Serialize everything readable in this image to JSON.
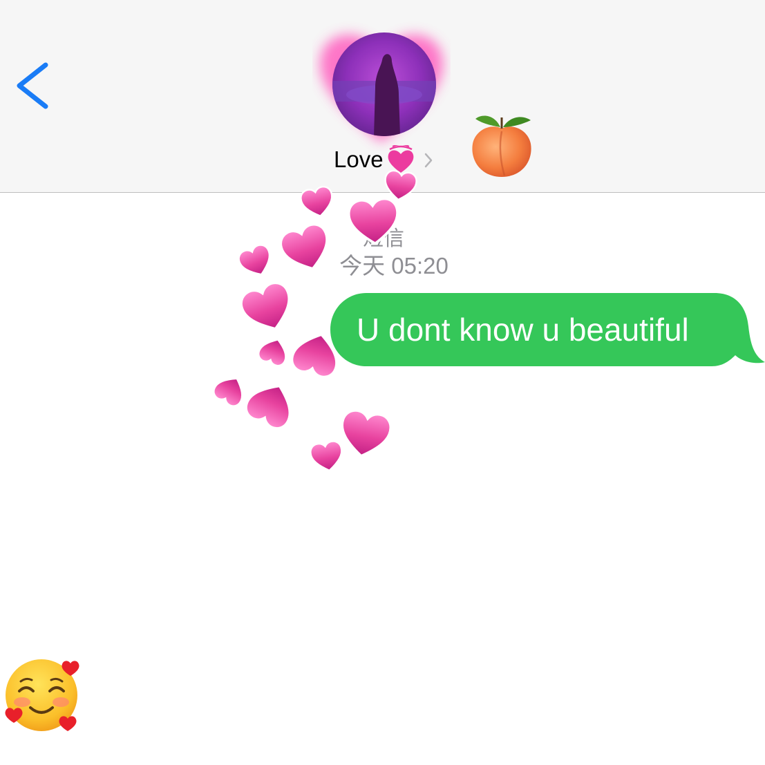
{
  "header": {
    "contact_name": "Love",
    "back_icon": "chevron-left-icon",
    "chevron_icon": "chevron-right-icon",
    "name_emoji": "sparkling-heart-icon",
    "decoration_emoji": "peach-icon"
  },
  "conversation": {
    "service_label": "短信",
    "timestamp": "今天  05:20",
    "messages": [
      {
        "direction": "outgoing",
        "text": "U dont know u beautiful"
      }
    ]
  },
  "stickers": [
    "floating-pink-hearts",
    "smiling-face-with-hearts-icon"
  ],
  "colors": {
    "accent_blue": "#1a7cf6",
    "sms_bubble": "#35c759",
    "timestamp_gray": "#8e8e93",
    "header_bg": "#f6f6f6",
    "heart_pink": "#e8439f"
  }
}
